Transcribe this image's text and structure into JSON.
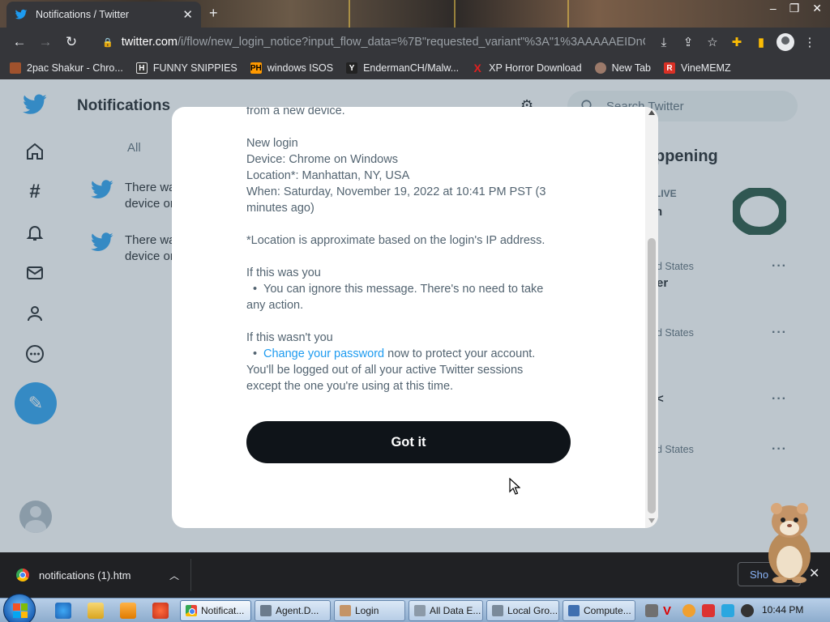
{
  "browser": {
    "tab": {
      "title": "Notifications / Twitter"
    },
    "address": {
      "host": "twitter.com",
      "path": "/i/flow/new_login_notice?input_flow_data=%7B\"requested_variant\"%3A\"1%3AAAAAEIDnO..."
    },
    "bookmarks": [
      {
        "label": "2pac Shakur - Chro...",
        "icon": "tupac-favicon",
        "color": "#a0522d"
      },
      {
        "label": "FUNNY SNIPPIES",
        "icon": "h-favicon",
        "color": "#333333"
      },
      {
        "label": "windows ISOS",
        "icon": "ph-favicon",
        "color": "#ff9900"
      },
      {
        "label": "EndermanCH/Malw...",
        "icon": "yp-favicon",
        "color": "#222222"
      },
      {
        "label": "XP Horror Download",
        "icon": "x-favicon",
        "color": "#e02020"
      },
      {
        "label": "New Tab",
        "icon": "globe-favicon",
        "color": "#9c7a6a"
      },
      {
        "label": "VineMEMZ",
        "icon": "r-favicon",
        "color": "#d93025"
      }
    ]
  },
  "twitter": {
    "title": "Notifications",
    "tab_all": "All",
    "notifications": [
      {
        "line1": "There wa",
        "line2": "device or"
      },
      {
        "line1": "There wa",
        "line2": "device or"
      }
    ],
    "search_placeholder": "Search Twitter",
    "happening_title": "ppening",
    "live_label": "LIVE",
    "live_title_fragment": "n",
    "trends": [
      {
        "location": "d States",
        "name": "er"
      },
      {
        "location": "d States",
        "name": ""
      },
      {
        "location": "",
        "name": "<"
      },
      {
        "location": "d States",
        "name": ""
      }
    ]
  },
  "modal": {
    "intro_tail": "from a new device.",
    "heading": "New login",
    "device": "Device: Chrome on Windows",
    "location": "Location*: Manhattan, NY, USA",
    "when_line1": "When: Saturday, November 19, 2022 at 10:41 PM PST (3",
    "when_line2": "minutes ago)",
    "location_note": "*Location is approximate based on the login's IP address.",
    "if_you": "If this was you",
    "ignore_line1": "You can ignore this message. There's no need to take",
    "ignore_line2": "any action.",
    "if_not_you": "If this wasn't you",
    "change_password_link": "Change your password",
    "protect_text": " now to protect your account.",
    "logout_line1": "You'll be logged out of all your active Twitter sessions",
    "logout_line2": "except the one you're using at this time.",
    "button": "Got it"
  },
  "downloads": {
    "filename": "notifications (1).htm",
    "show_all": "Sho"
  },
  "taskbar": {
    "tasks": [
      {
        "label": "Notificat...",
        "active": true
      },
      {
        "label": "Agent.D...",
        "active": false
      },
      {
        "label": "Login",
        "active": false
      },
      {
        "label": "All Data E...",
        "active": false
      },
      {
        "label": "Local Gro...",
        "active": false
      },
      {
        "label": "Compute...",
        "active": false
      }
    ],
    "clock": "10:44 PM"
  },
  "colors": {
    "twitter_blue": "#1d9bf0",
    "button_black": "#0f1419",
    "overlay": "#5b7083",
    "oregon_green": "#154733"
  }
}
